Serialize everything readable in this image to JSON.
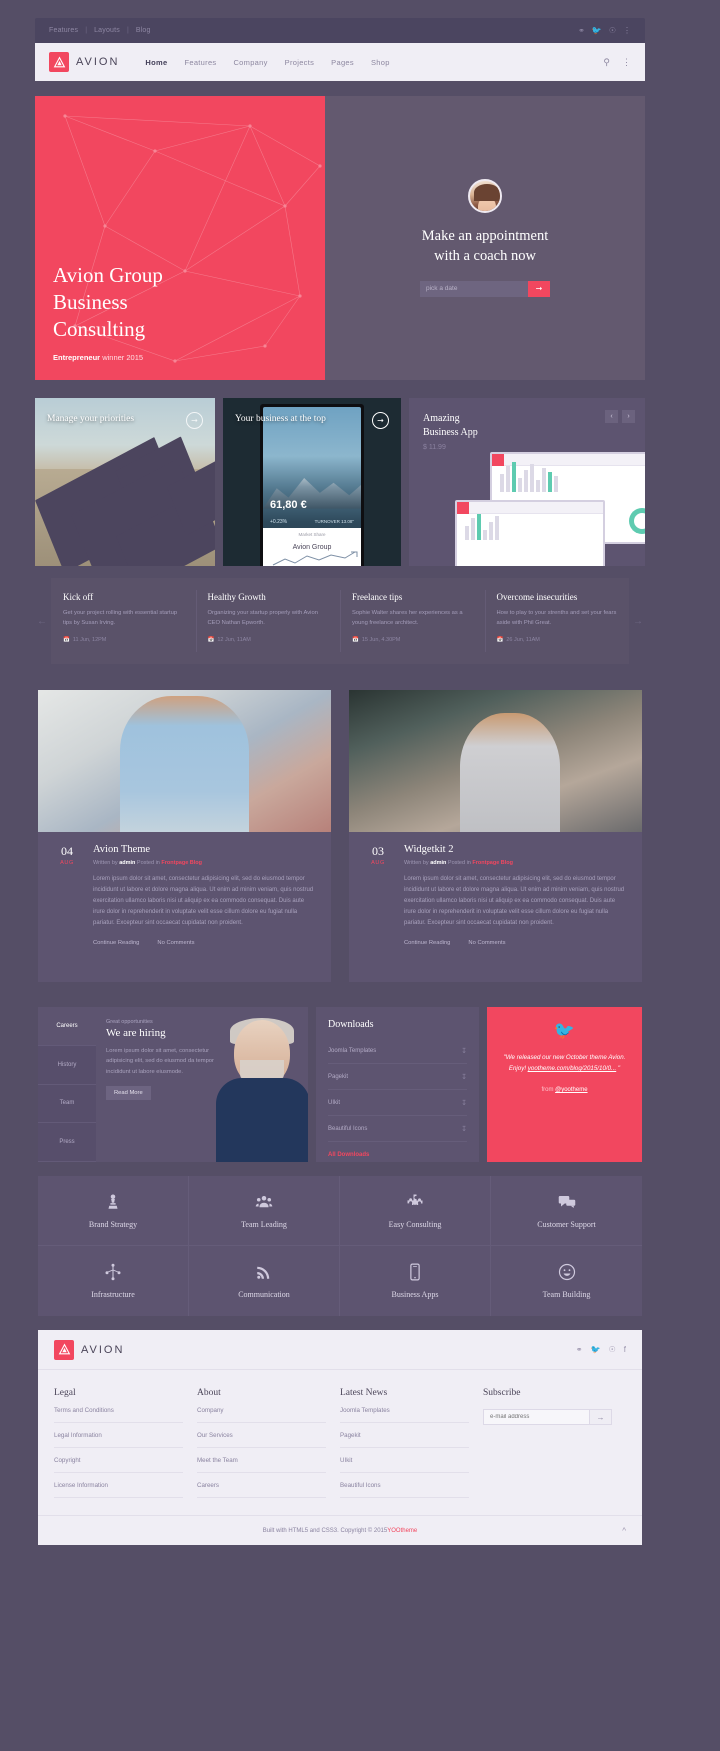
{
  "topbar": {
    "links": [
      "Features",
      "Layouts",
      "Blog"
    ],
    "social": [
      "github-icon",
      "twitter-icon",
      "google-plus-icon",
      "more-icon"
    ]
  },
  "nav": {
    "brand": "AVION",
    "items": [
      {
        "label": "Home",
        "active": true
      },
      {
        "label": "Features",
        "active": false
      },
      {
        "label": "Company",
        "active": false
      },
      {
        "label": "Projects",
        "active": false
      },
      {
        "label": "Pages",
        "active": false
      },
      {
        "label": "Shop",
        "active": false
      }
    ],
    "search_icon": "search-icon",
    "menu_icon": "kebab-menu-icon"
  },
  "hero": {
    "title_line1": "Avion Group",
    "title_line2": "Business",
    "title_line3": "Consulting",
    "sub_strong": "Entrepreneur",
    "sub_rest": " winner 2015",
    "appointment_line1": "Make an appointment",
    "appointment_line2": "with a coach now",
    "date_placeholder": "pick a date",
    "date_value": "",
    "submit_icon": "arrow-right-icon",
    "accent": "#f2475f"
  },
  "showcase": [
    {
      "label": "Manage your priorities",
      "arrow": "arrow-right-icon"
    },
    {
      "label": "Your business at the top",
      "arrow": "arrow-right-icon",
      "price": "61,80 €",
      "change": "+0.23%",
      "change2": "TURNOVER 13.08\"",
      "chart_caption": "Market Share",
      "brand": "Avion Group"
    },
    {
      "title_line1": "Amazing",
      "title_line2": "Business App",
      "price": "$ 11.99",
      "prev": "‹",
      "next": "›"
    }
  ],
  "ticker": {
    "prev_icon": "arrow-left-icon",
    "next_icon": "arrow-right-icon",
    "items": [
      {
        "title": "Kick off",
        "text": "Get your project rolling with essential startup tips by Susan Irving.",
        "date": "11 Jun, 12PM"
      },
      {
        "title": "Healthy Growth",
        "text": "Organizing your startup properly with Avion CEO Nathan Epworth.",
        "date": "12 Jun, 11AM"
      },
      {
        "title": "Freelance tips",
        "text": "Sophie Walter shares her experiences as a young freelance architect.",
        "date": "15 Jun, 4.30PM"
      },
      {
        "title": "Overcome insecurities",
        "text": "How to play to your strenths and set your fears aside with Phil Great.",
        "date": "26 Jun, 11AM"
      }
    ]
  },
  "blog": [
    {
      "day": "04",
      "month": "AUG",
      "title": "Avion Theme",
      "meta_pre": "Written by ",
      "meta_author": "admin",
      "meta_mid": " Posted in ",
      "meta_cat": "Frontpage Blog",
      "text": "Lorem ipsum dolor sit amet, consectetur adipisicing elit, sed do eiusmod tempor incididunt ut labore et dolore magna aliqua. Ut enim ad minim veniam, quis nostrud exercitation ullamco laboris nisi ut aliquip ex ea commodo consequat. Duis aute irure dolor in reprehenderit in voluptate velit esse cillum dolore eu fugiat nulla pariatur. Excepteur sint occaecat cupidatat non proident.",
      "link1": "Continue Reading",
      "link2": "No Comments"
    },
    {
      "day": "03",
      "month": "AUG",
      "title": "Widgetkit 2",
      "meta_pre": "Written by ",
      "meta_author": "admin",
      "meta_mid": " Posted in ",
      "meta_cat": "Frontpage Blog",
      "text": "Lorem ipsum dolor sit amet, consectetur adipisicing elit, sed do eiusmod tempor incididunt ut labore et dolore magna aliqua. Ut enim ad minim veniam, quis nostrud exercitation ullamco laboris nisi ut aliquip ex ea commodo consequat. Duis aute irure dolor in reprehenderit in voluptate velit esse cillum dolore eu fugiat nulla pariatur. Excepteur sint occaecat cupidatat non proident.",
      "link1": "Continue Reading",
      "link2": "No Comments"
    }
  ],
  "careers": {
    "tabs": [
      {
        "label": "Careers",
        "active": true
      },
      {
        "label": "History",
        "active": false
      },
      {
        "label": "Team",
        "active": false
      },
      {
        "label": "Press",
        "active": false
      }
    ],
    "eyebrow": "Great opportunities",
    "heading": "We are hiring",
    "text": "Lorem ipsum dolor sit amet, consectetur adipisicing elit, sed do eiusmod da tempor incididunt ut labore eiusmode.",
    "button": "Read More"
  },
  "downloads": {
    "heading": "Downloads",
    "items": [
      {
        "label": "Joomla Templates",
        "icon": "download-icon"
      },
      {
        "label": "Pagekit",
        "icon": "download-icon"
      },
      {
        "label": "UIkit",
        "icon": "download-icon"
      },
      {
        "label": "Beautiful Icons",
        "icon": "download-icon"
      }
    ],
    "all": "All Downloads"
  },
  "twitter": {
    "icon": "twitter-icon",
    "tweet": "\"We released our new October theme Avion. Enjoy! yootheme.com/blog/2015/10/0... \"",
    "tweet_plain": "\"We released our new October theme Avion. Enjoy!",
    "tweet_link": "yootheme.com/blog/2015/10/0...",
    "via_label": "from ",
    "via_handle": "@yootheme",
    "bg": "#f2475f"
  },
  "services": [
    {
      "label": "Brand Strategy",
      "icon": "chess-pawn-icon"
    },
    {
      "label": "Team Leading",
      "icon": "users-icon"
    },
    {
      "label": "Easy Consulting",
      "icon": "puzzle-piece-icon"
    },
    {
      "label": "Customer Support",
      "icon": "chat-bubbles-icon"
    },
    {
      "label": "Infrastructure",
      "icon": "sitemap-icon"
    },
    {
      "label": "Communication",
      "icon": "rss-signal-icon"
    },
    {
      "label": "Business Apps",
      "icon": "mobile-phone-icon"
    },
    {
      "label": "Team Building",
      "icon": "smiley-face-icon"
    }
  ],
  "footer": {
    "brand": "AVION",
    "social": [
      "github-icon",
      "twitter-icon",
      "google-plus-icon",
      "facebook-icon"
    ],
    "columns": [
      {
        "heading": "Legal",
        "links": [
          "Terms and Conditions",
          "Legal Information",
          "Copyright",
          "License Information"
        ]
      },
      {
        "heading": "About",
        "links": [
          "Company",
          "Our Services",
          "Meet the Team",
          "Careers"
        ]
      },
      {
        "heading": "Latest News",
        "links": [
          "Joomla Templates",
          "Pagekit",
          "UIkit",
          "Beautiful Icons"
        ]
      }
    ],
    "subscribe": {
      "heading": "Subscribe",
      "placeholder": "e-mail address",
      "value": "",
      "submit_icon": "arrow-right-icon"
    },
    "copyright_pre": "Built with HTML5 and CSS3. Copyright © 2015 ",
    "copyright_brand": "YOOtheme",
    "back_to_top_icon": "chevron-up-icon"
  }
}
